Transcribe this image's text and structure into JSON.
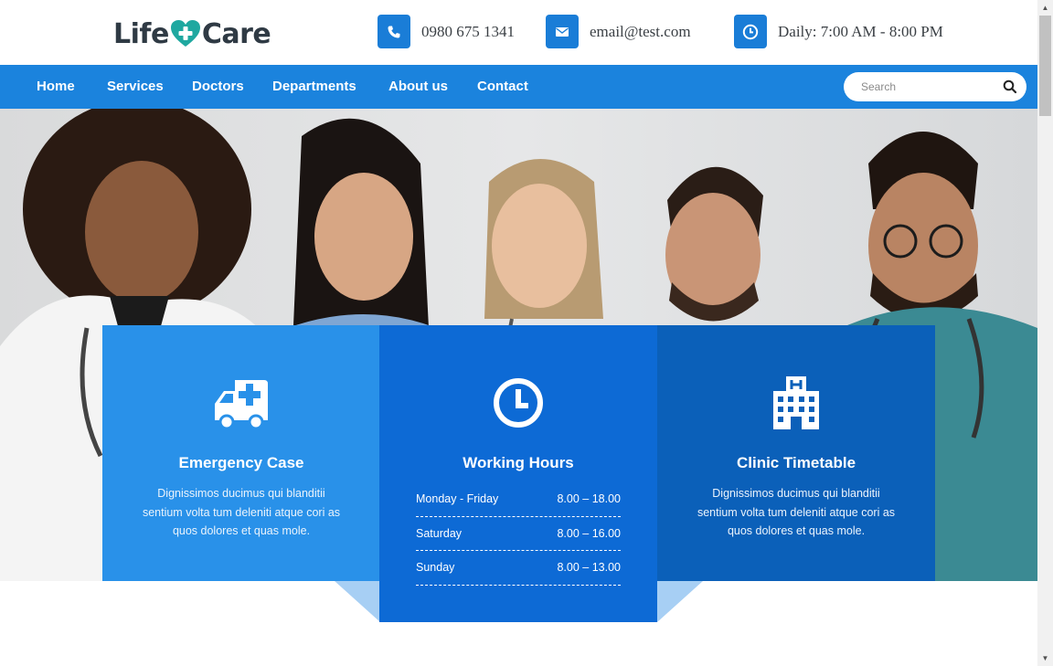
{
  "brand": {
    "name_part1": "Life",
    "name_part2": "Care"
  },
  "contacts": {
    "phone": {
      "icon": "phone-icon",
      "text": "0980 675 1341"
    },
    "email": {
      "icon": "envelope-icon",
      "text": "email@test.com"
    },
    "hours": {
      "icon": "clock-icon",
      "text": "Daily: 7:00 AM - 8:00 PM"
    }
  },
  "nav": {
    "items": [
      "Home",
      "Services",
      "Doctors",
      "Departments",
      "About us",
      "Contact"
    ],
    "search_placeholder": "Search"
  },
  "cards": {
    "emergency": {
      "icon": "ambulance-icon",
      "title": "Emergency Case",
      "text": "Dignissimos ducimus qui blanditii sentium volta tum deleniti atque cori as quos dolores et quas mole."
    },
    "working_hours": {
      "icon": "clock-icon",
      "title": "Working Hours",
      "rows": [
        {
          "day": "Monday - Friday",
          "time": "8.00 – 18.00"
        },
        {
          "day": "Saturday",
          "time": "8.00 – 16.00"
        },
        {
          "day": "Sunday",
          "time": "8.00 – 13.00"
        }
      ]
    },
    "timetable": {
      "icon": "hospital-icon",
      "title": "Clinic Timetable",
      "text": "Dignissimos ducimus qui blanditii sentium volta tum deleniti atque cori as quos dolores et quas mole."
    }
  },
  "colors": {
    "primary": "#1b83dd",
    "card_light": "#2991e9",
    "card_mid": "#0d6ad5",
    "card_dark": "#0b60b9",
    "logo_accent": "#1fa8a0"
  }
}
